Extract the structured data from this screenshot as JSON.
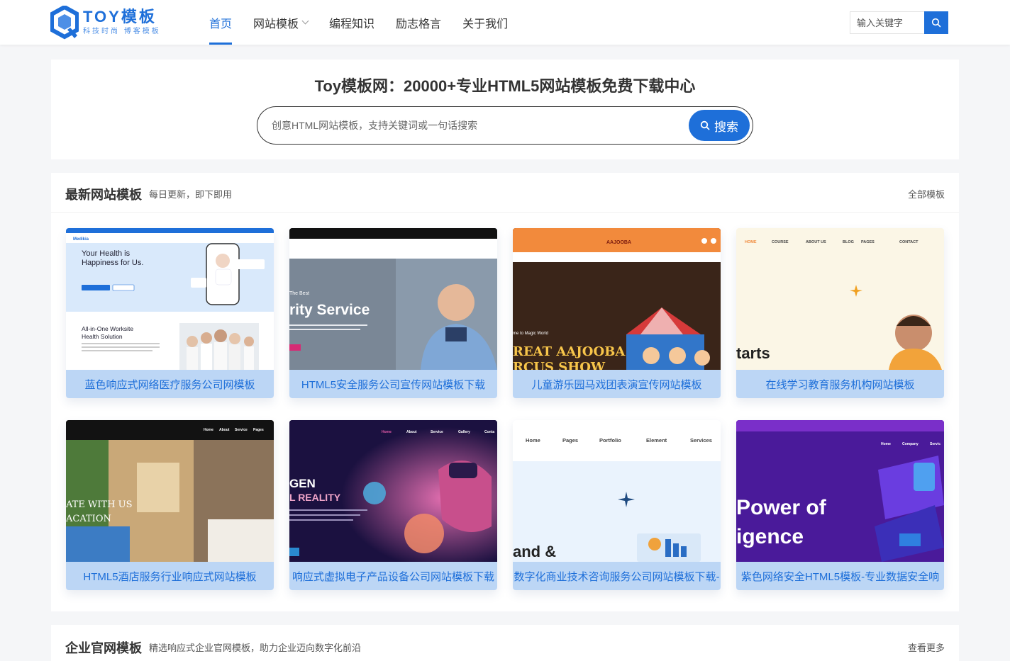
{
  "header": {
    "logo_title": "TOY模板",
    "logo_subtitle": "科技时尚 博客模板",
    "nav": [
      {
        "label": "首页",
        "active": true,
        "dropdown": false
      },
      {
        "label": "网站模板",
        "active": false,
        "dropdown": true
      },
      {
        "label": "编程知识",
        "active": false,
        "dropdown": false
      },
      {
        "label": "励志格言",
        "active": false,
        "dropdown": false
      },
      {
        "label": "关于我们",
        "active": false,
        "dropdown": false
      }
    ],
    "search_placeholder": "输入关键字",
    "search_icon": "search-icon"
  },
  "hero": {
    "title": "Toy模板网：20000+专业HTML5网站模板免费下载中心",
    "search_placeholder": "创意HTML网站模板，支持关键词或一句话搜索",
    "search_button": "搜索"
  },
  "latest": {
    "title": "最新网站模板",
    "subtitle": "每日更新，即下即用",
    "more": "全部模板",
    "cards": [
      {
        "caption": "蓝色响应式网络医疗服务公司网模板",
        "thumb": {
          "t1": "Your Health is",
          "t2": "Happiness for Us.",
          "t3": "All-in-One Worksite",
          "t4": "Health Solution",
          "brand": "Medikia"
        }
      },
      {
        "caption": "HTML5安全服务公司宣传网站模板下载",
        "thumb": {
          "t1": "The Best",
          "t2": "rity Service"
        }
      },
      {
        "caption": "儿童游乐园马戏团表演宣传网站模板",
        "thumb": {
          "t1": "me to Magic World",
          "t2": "REAT AAJOOBA",
          "t3": "RCUS SHOW",
          "brand": "AAJOOBA"
        }
      },
      {
        "caption": "在线学习教育服务机构网站模板",
        "thumb": {
          "t1": "tarts",
          "nav": [
            "HOME",
            "COURSE",
            "ABOUT US",
            "BLOG",
            "PAGES",
            "CONTACT"
          ]
        }
      },
      {
        "caption": "HTML5酒店服务行业响应式网站模板",
        "thumb": {
          "t1": "ATE WITH US",
          "t2": "ACATION",
          "nav": [
            "Home",
            "About",
            "Service",
            "Pages"
          ]
        }
      },
      {
        "caption": "响应式虚拟电子产品设备公司网站模板下载",
        "thumb": {
          "t1": "GEN",
          "t2": "L REALITY",
          "nav": [
            "Home",
            "About",
            "Service",
            "Gallery",
            "Conta"
          ]
        }
      },
      {
        "caption": "数字化商业技术咨询服务公司网站模板下载-",
        "thumb": {
          "t1": "and &",
          "nav": [
            "Home",
            "Pages",
            "Portfolio",
            "Element",
            "Services"
          ]
        }
      },
      {
        "caption": "紫色网络安全HTML5模板-专业数据安全响",
        "thumb": {
          "t1": "Power of",
          "t2": "igence",
          "nav": [
            "Home",
            "Company",
            "Servic"
          ]
        }
      }
    ]
  },
  "enterprise": {
    "title": "企业官网模板",
    "subtitle": "精选响应式企业官网模板，助力企业迈向数字化前沿",
    "more": "查看更多"
  },
  "colors": {
    "accent": "#1e6fd9",
    "caption_bg": "#bcd6f5"
  }
}
